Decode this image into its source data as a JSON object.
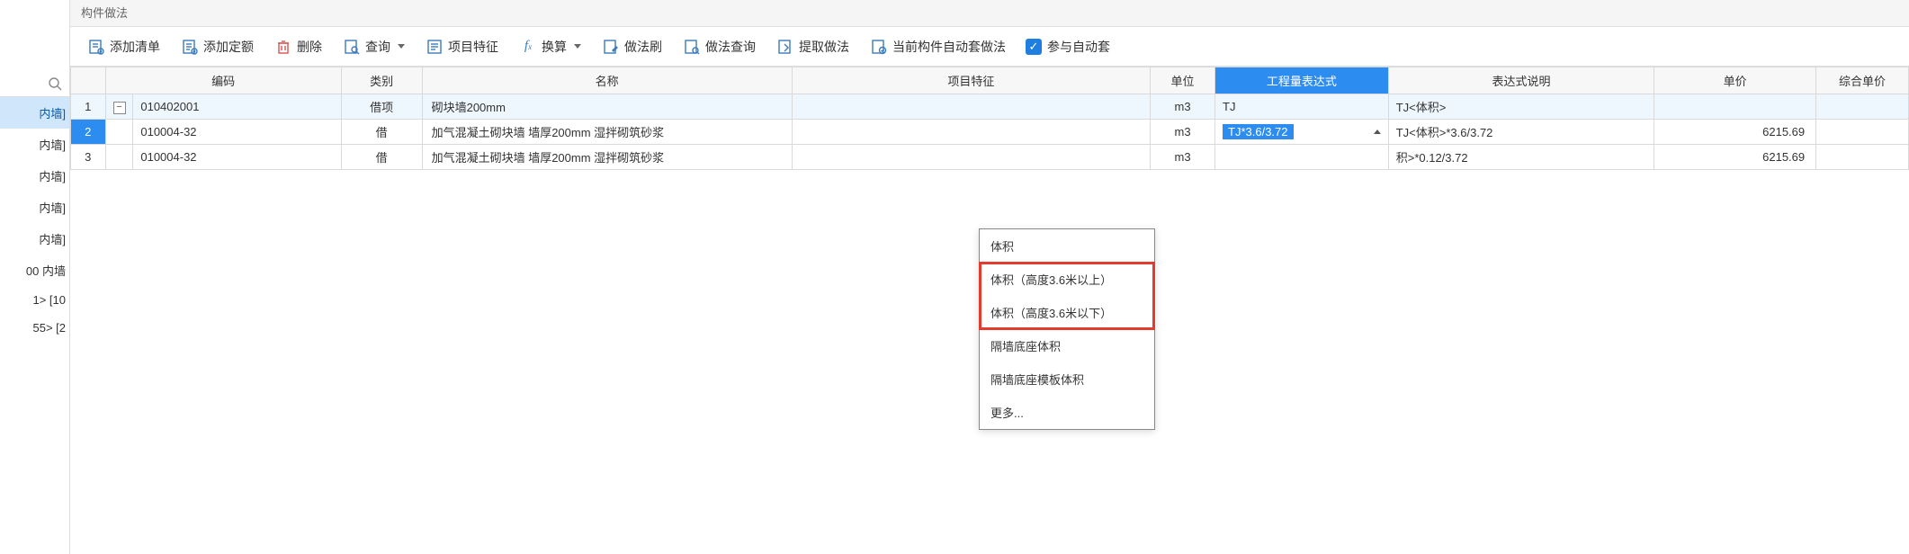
{
  "left_panel": {
    "items": [
      {
        "label": "内墙]",
        "selected": true
      },
      {
        "label": "内墙]"
      },
      {
        "label": "内墙]"
      },
      {
        "label": "内墙]"
      },
      {
        "label": "内墙]"
      },
      {
        "label": "00 内墙"
      },
      {
        "label": "1> [10"
      },
      {
        "label": "55> [2"
      }
    ]
  },
  "panel": {
    "title": "构件做法"
  },
  "toolbar": {
    "add_list": "添加清单",
    "add_quota": "添加定额",
    "delete": "删除",
    "query": "查询",
    "item_feature": "项目特征",
    "convert": "换算",
    "method_brush": "做法刷",
    "method_query": "做法查询",
    "extract_method": "提取做法",
    "auto_set": "当前构件自动套做法",
    "auto_check": "参与自动套"
  },
  "columns": {
    "code": "编码",
    "cat": "类别",
    "name": "名称",
    "feat": "项目特征",
    "unit": "单位",
    "expr": "工程量表达式",
    "desc": "表达式说明",
    "price": "单价",
    "comp": "综合单价"
  },
  "rows": [
    {
      "num": "1",
      "code": "010402001",
      "cat": "借项",
      "name": "砌块墙200mm",
      "feat": "",
      "unit": "m3",
      "expr": "TJ",
      "desc": "TJ<体积>",
      "price": "",
      "parent": true
    },
    {
      "num": "2",
      "code": "010004-32",
      "cat": "借",
      "name": "加气混凝土砌块墙 墙厚200mm 湿拌砌筑砂浆",
      "feat": "",
      "unit": "m3",
      "expr": "TJ*3.6/3.72",
      "desc": "TJ<体积>*3.6/3.72",
      "price": "6215.69",
      "selected": true,
      "expr_active": true
    },
    {
      "num": "3",
      "code": "010004-32",
      "cat": "借",
      "name": "加气混凝土砌块墙 墙厚200mm 湿拌砌筑砂浆",
      "feat": "",
      "unit": "m3",
      "expr": "",
      "desc": "积>*0.12/3.72",
      "price": "6215.69"
    }
  ],
  "dropdown": {
    "items": [
      {
        "label": "体积"
      },
      {
        "label": "体积（高度3.6米以上）",
        "hl": true
      },
      {
        "label": "体积（高度3.6米以下）",
        "hl": true
      },
      {
        "label": "隔墙底座体积"
      },
      {
        "label": "隔墙底座模板体积"
      },
      {
        "label": "更多..."
      }
    ]
  }
}
